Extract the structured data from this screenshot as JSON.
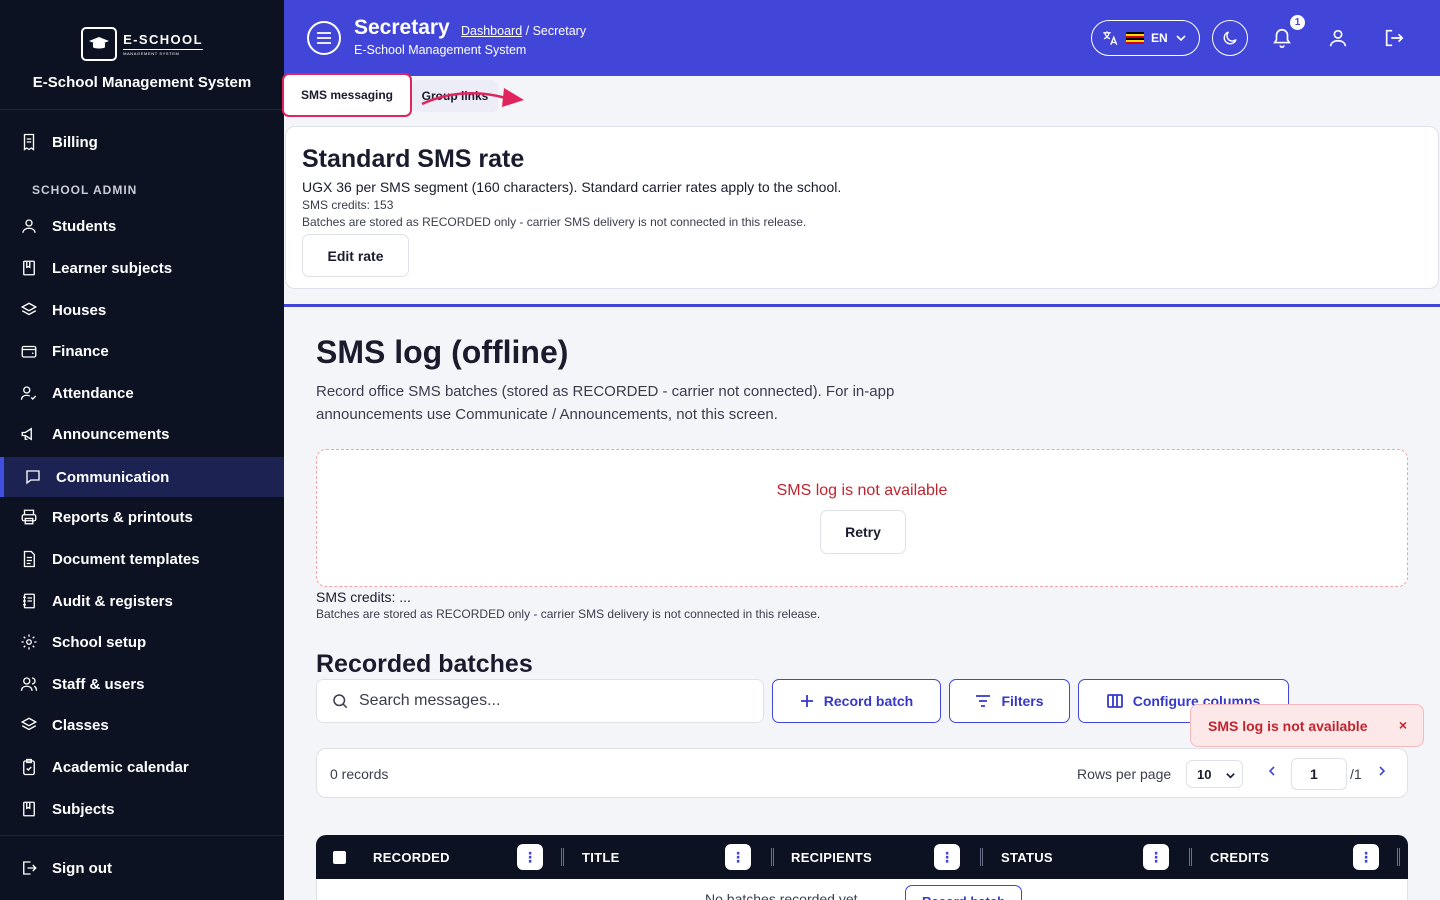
{
  "sidebar": {
    "logo_title": "E-SCHOOL",
    "logo_subtitle": "MANAGEMENT SYSTEM",
    "app_name": "E-School Management System",
    "billing": "Billing",
    "section_label": "SCHOOL ADMIN",
    "items": [
      {
        "label": "Students",
        "icon": "user-icon"
      },
      {
        "label": "Learner subjects",
        "icon": "book-icon"
      },
      {
        "label": "Houses",
        "icon": "layers-icon"
      },
      {
        "label": "Finance",
        "icon": "wallet-icon"
      },
      {
        "label": "Attendance",
        "icon": "user-check-icon"
      },
      {
        "label": "Announcements",
        "icon": "megaphone-icon"
      },
      {
        "label": "Communication",
        "icon": "chat-icon",
        "active": true
      },
      {
        "label": "Reports & printouts",
        "icon": "printer-icon"
      },
      {
        "label": "Document templates",
        "icon": "document-icon"
      },
      {
        "label": "Audit & registers",
        "icon": "register-icon"
      },
      {
        "label": "School setup",
        "icon": "gear-icon"
      },
      {
        "label": "Staff & users",
        "icon": "users-icon"
      },
      {
        "label": "Classes",
        "icon": "layers-icon"
      },
      {
        "label": "Academic calendar",
        "icon": "clipboard-icon"
      },
      {
        "label": "Subjects",
        "icon": "book-icon"
      }
    ],
    "sign_out": "Sign out"
  },
  "header": {
    "title": "Secretary",
    "breadcrumb_link": "Dashboard",
    "breadcrumb_current": "/ Secretary",
    "subtitle": "E-School Management System",
    "language": "EN",
    "notification_count": "1",
    "accent_color": "#4145d8"
  },
  "tabs": {
    "sms_messaging": "SMS messaging",
    "group_links": "Group links"
  },
  "rate_card": {
    "title": "Standard SMS rate",
    "description": "UGX 36 per SMS segment (160 characters). Standard carrier rates apply to the school.",
    "credits": "SMS credits: 153",
    "note": "Batches are stored as RECORDED only - carrier SMS delivery is not connected in this release.",
    "edit_button": "Edit rate"
  },
  "sms_log": {
    "title": "SMS log (offline)",
    "description": "Record office SMS batches (stored as RECORDED - carrier not connected). For in-app announcements use Communicate / Announcements, not this screen.",
    "error": "SMS log is not available",
    "retry": "Retry",
    "credits": "SMS credits: ...",
    "note": "Batches are stored as RECORDED only - carrier SMS delivery is not connected in this release."
  },
  "batches": {
    "title": "Recorded batches",
    "search_placeholder": "Search messages...",
    "record_batch": "Record batch",
    "filters": "Filters",
    "configure_columns": "Configure columns",
    "records": "0 records",
    "rows_per_page_label": "Rows per page",
    "rows_per_page": "10",
    "page": "1",
    "page_total": "/1",
    "columns": [
      "RECORDED",
      "TITLE",
      "RECIPIENTS",
      "STATUS",
      "CREDITS"
    ],
    "empty_text": "No batches recorded yet.",
    "empty_button": "Record batch"
  },
  "toast": {
    "message": "SMS log is not available",
    "close": "×"
  }
}
